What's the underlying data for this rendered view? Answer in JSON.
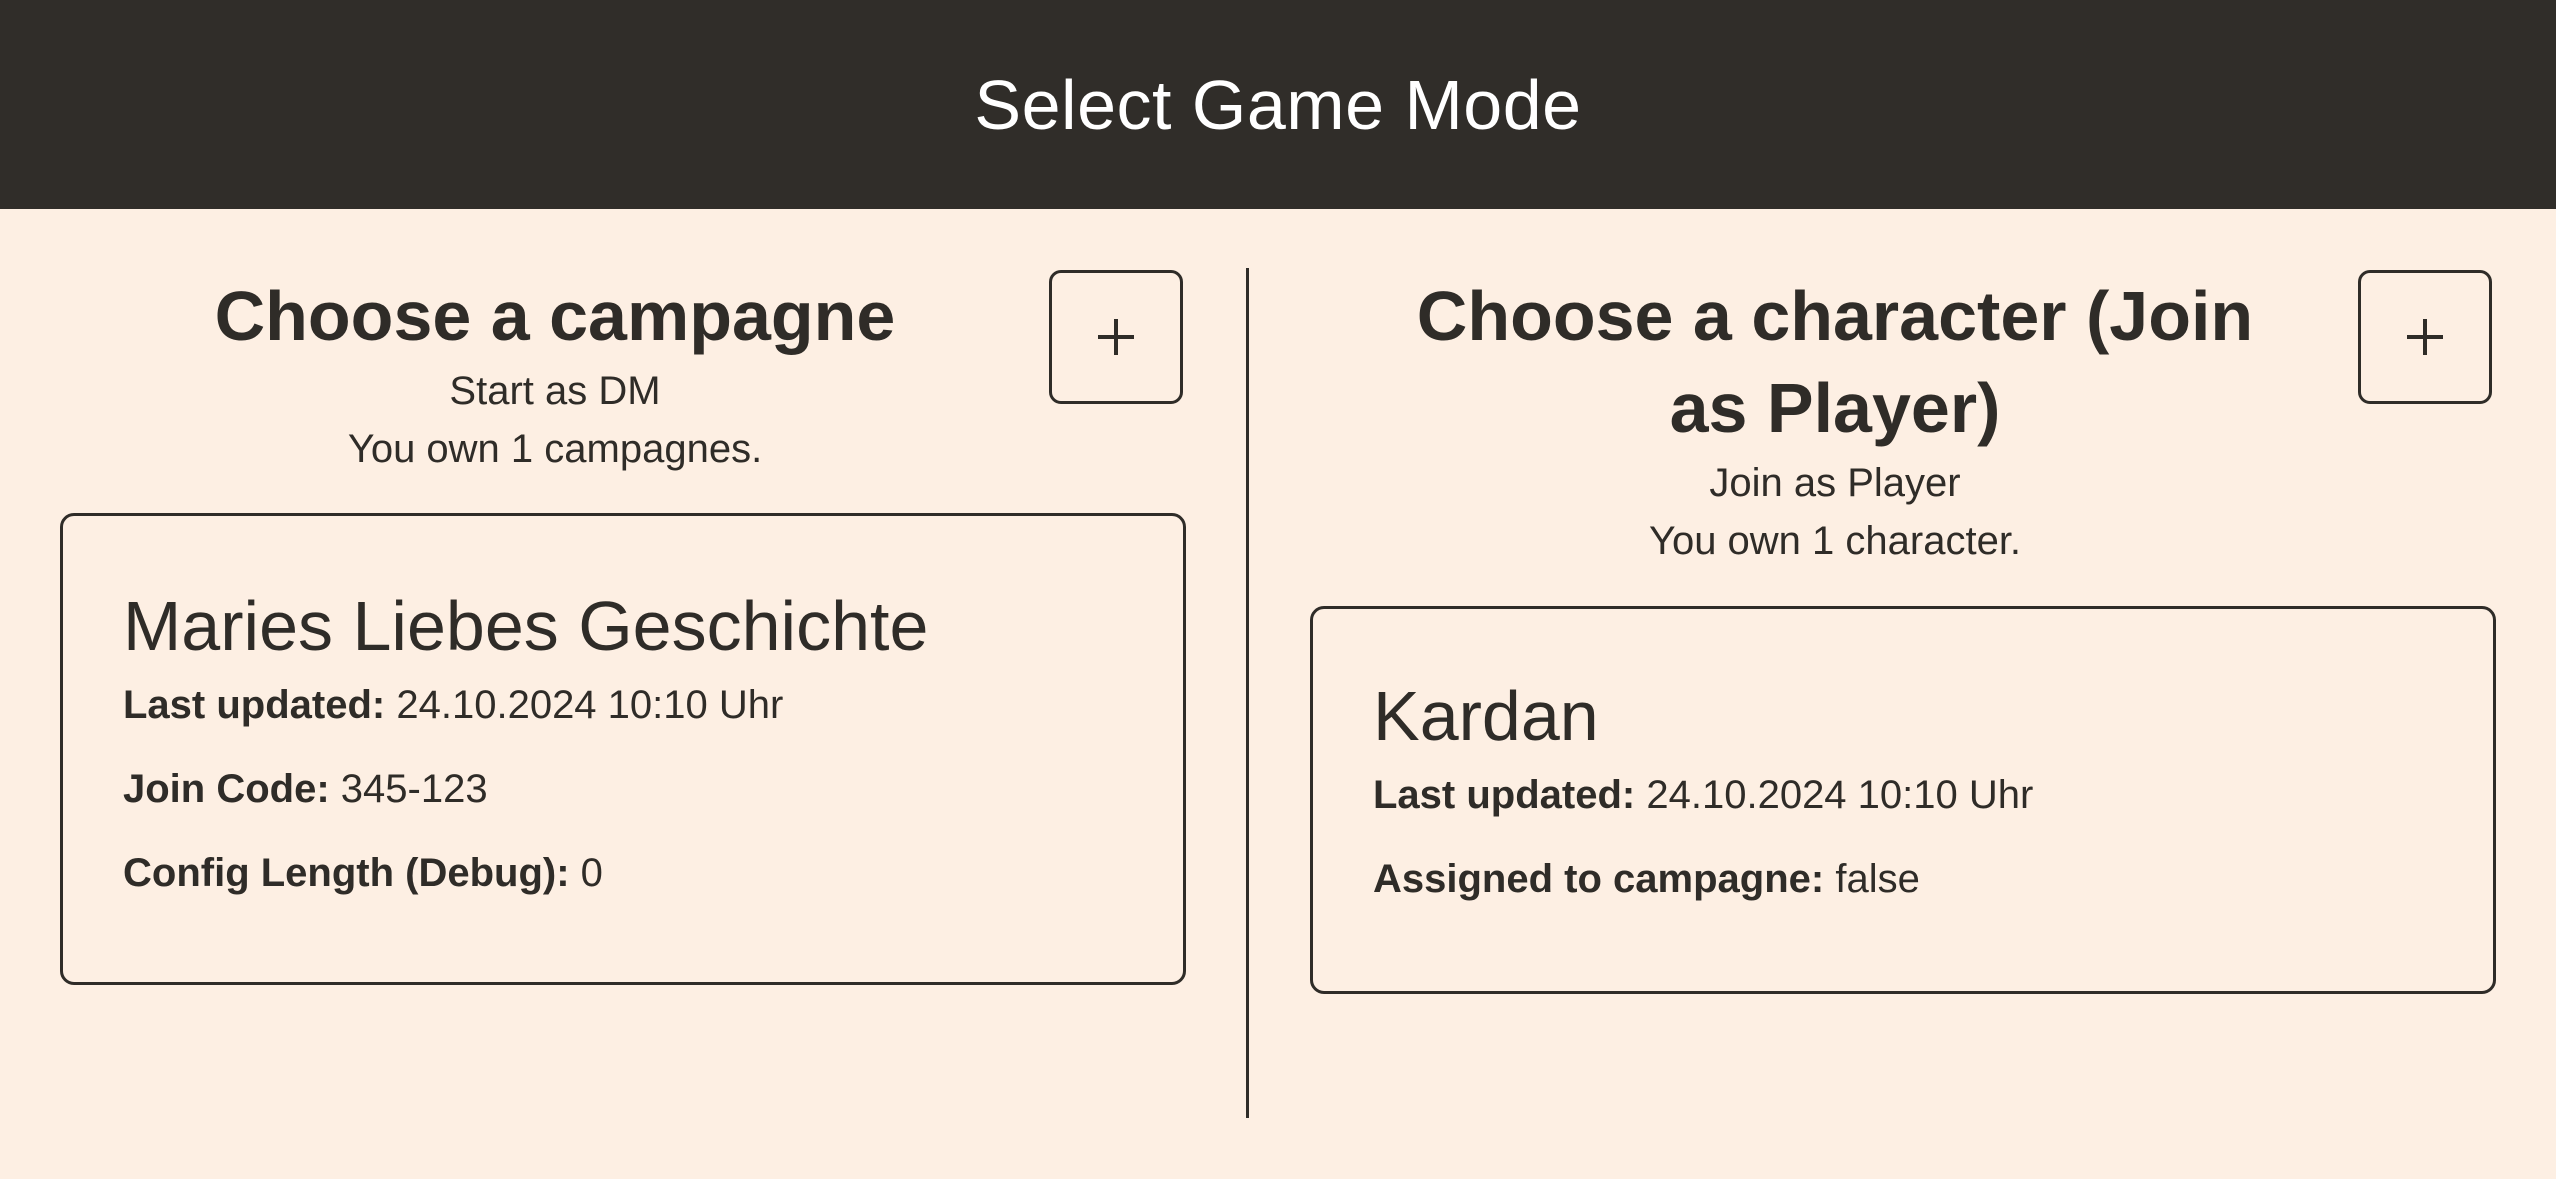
{
  "header": {
    "title": "Select Game Mode"
  },
  "campaigns": {
    "heading": "Choose a campagne",
    "subtitle": "Start as DM",
    "count_text": "You own 1 campagnes.",
    "add_button_symbol": "+",
    "items": [
      {
        "name": "Maries Liebes Geschichte",
        "last_updated_label": "Last updated:",
        "last_updated_value": "24.10.2024 10:10 Uhr",
        "join_code_label": "Join Code:",
        "join_code_value": "345-123",
        "config_length_label": "Config Length (Debug):",
        "config_length_value": "0"
      }
    ]
  },
  "characters": {
    "heading": "Choose a character (Join as Player)",
    "subtitle": "Join as Player",
    "count_text": "You own 1 character.",
    "add_button_symbol": "+",
    "items": [
      {
        "name": "Kardan",
        "last_updated_label": "Last updated:",
        "last_updated_value": "24.10.2024 10:10 Uhr",
        "assigned_label": "Assigned to campagne:",
        "assigned_value": "false"
      }
    ]
  },
  "colors": {
    "background": "#fdefe3",
    "header_bar": "#302d29",
    "text": "#2f2c28",
    "header_text": "#ffffff"
  },
  "icons": {
    "add": "plus-icon"
  }
}
